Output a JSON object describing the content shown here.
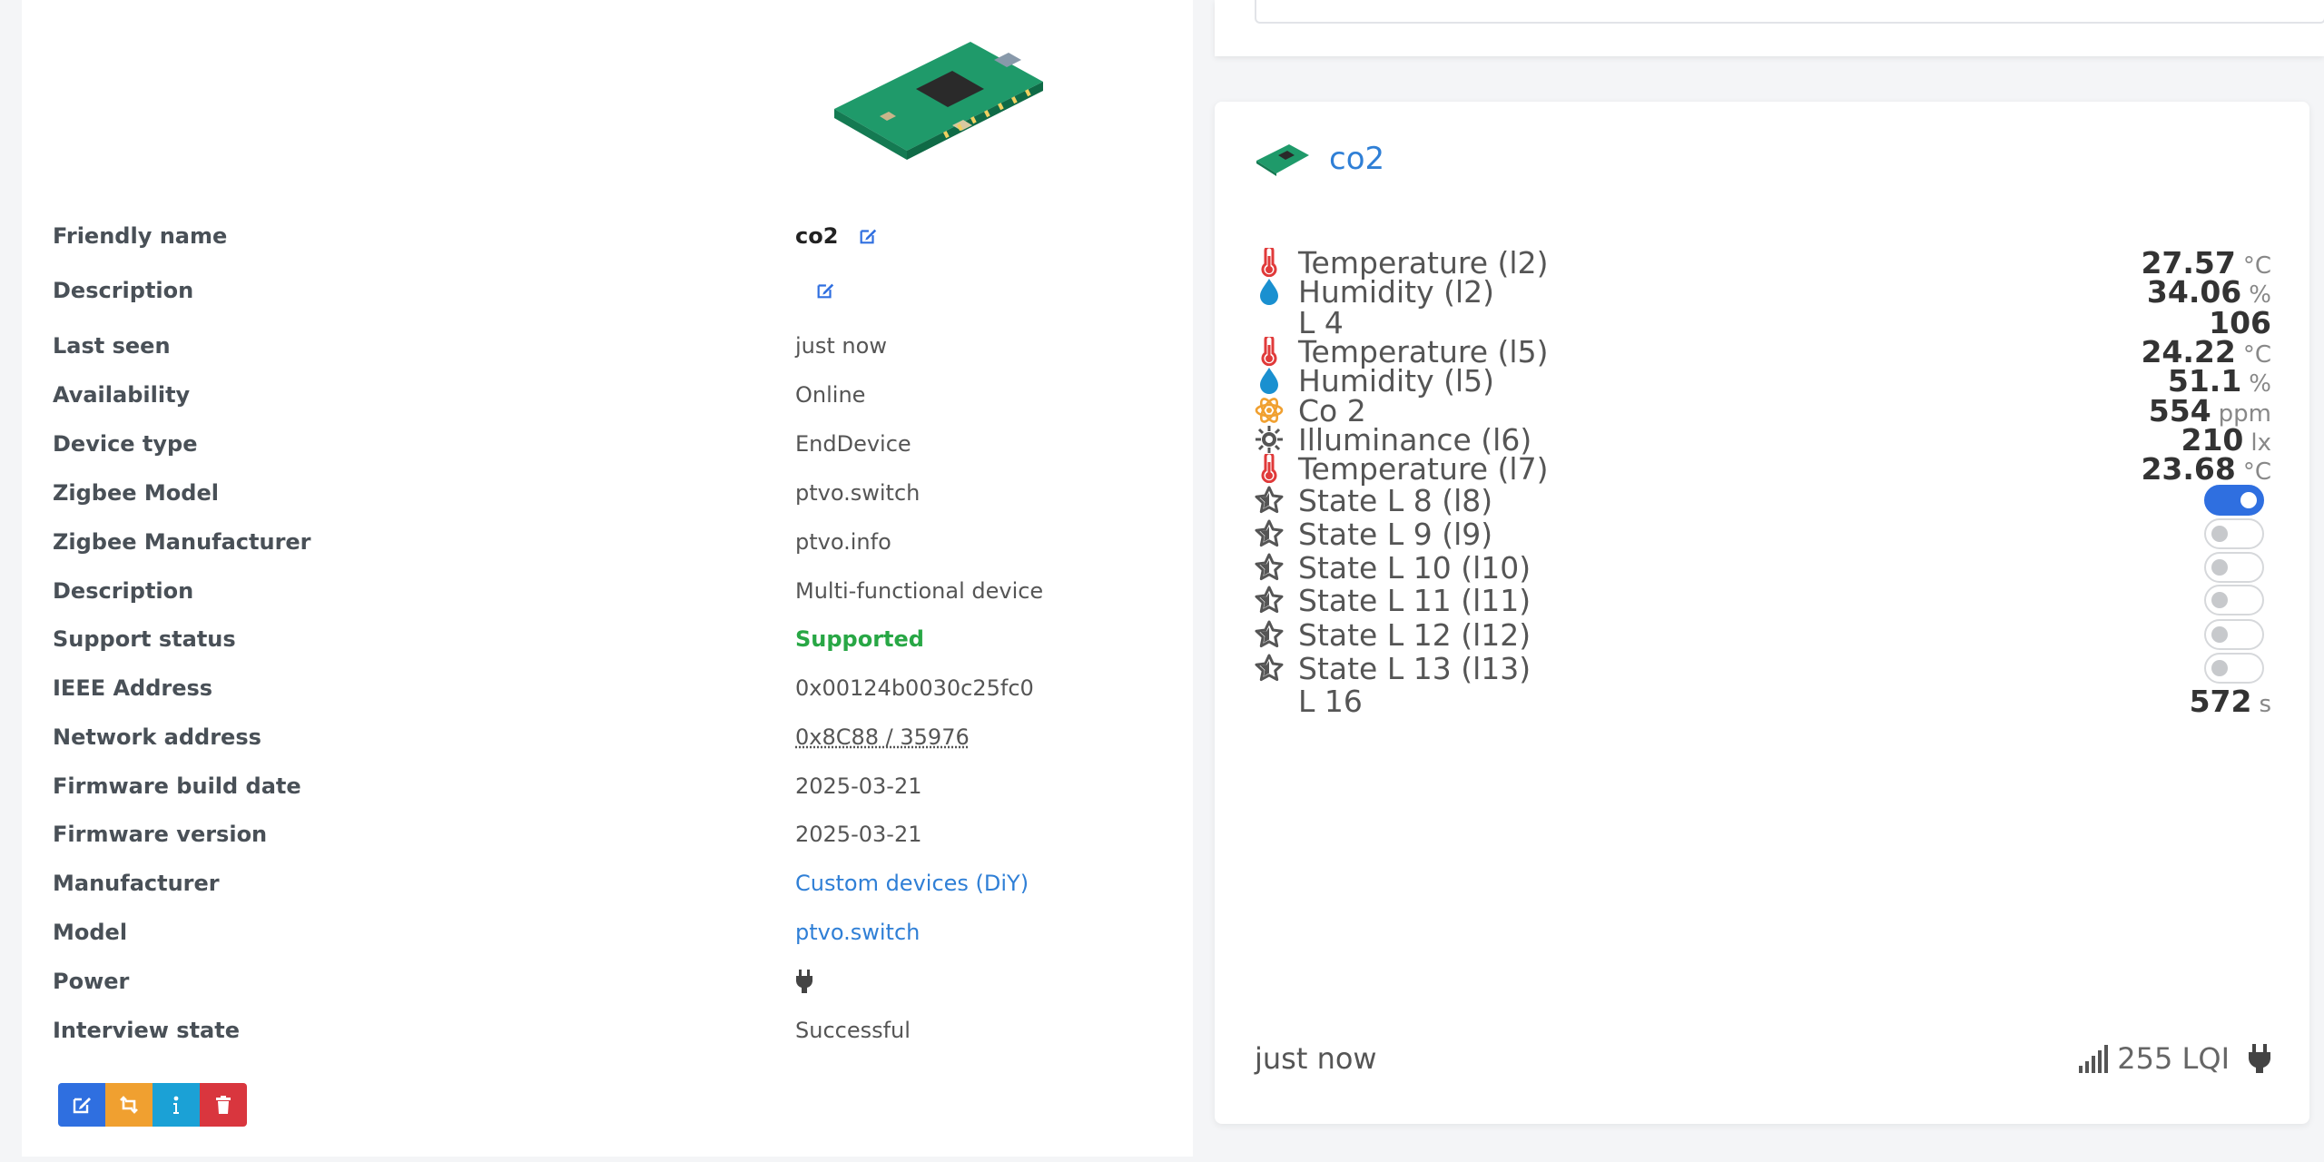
{
  "device_info": {
    "rows": [
      {
        "label": "Friendly name",
        "value": "co2"
      },
      {
        "label": "Description",
        "value": ""
      },
      {
        "label": "Last seen",
        "value": "just now"
      },
      {
        "label": "Availability",
        "value": "Online"
      },
      {
        "label": "Device type",
        "value": "EndDevice"
      },
      {
        "label": "Zigbee Model",
        "value": "ptvo.switch"
      },
      {
        "label": "Zigbee Manufacturer",
        "value": "ptvo.info"
      },
      {
        "label": "Description",
        "value": "Multi-functional device"
      },
      {
        "label": "Support status",
        "value": "Supported"
      },
      {
        "label": "IEEE Address",
        "value": "0x00124b0030c25fc0"
      },
      {
        "label": "Network address",
        "value": "0x8C88 / 35976"
      },
      {
        "label": "Firmware build date",
        "value": "2025-03-21"
      },
      {
        "label": "Firmware version",
        "value": "2025-03-21"
      },
      {
        "label": "Manufacturer",
        "value": "Custom devices (DiY)"
      },
      {
        "label": "Model",
        "value": "ptvo.switch"
      },
      {
        "label": "Power",
        "value": ""
      },
      {
        "label": "Interview state",
        "value": "Successful"
      }
    ]
  },
  "actions": [
    "edit-icon",
    "rename-icon",
    "info-icon",
    "trash-icon"
  ],
  "card": {
    "title": "co2",
    "features": [
      {
        "icon": "thermometer-icon",
        "label": "Temperature (l2)",
        "value": "27.57",
        "unit": "°C"
      },
      {
        "icon": "droplet-icon",
        "label": "Humidity (l2)",
        "value": "34.06",
        "unit": "%"
      },
      {
        "icon": "",
        "label": "L 4",
        "value": "106",
        "unit": ""
      },
      {
        "icon": "thermometer-icon",
        "label": "Temperature (l5)",
        "value": "24.22",
        "unit": "°C"
      },
      {
        "icon": "droplet-icon",
        "label": "Humidity (l5)",
        "value": "51.1",
        "unit": "%"
      },
      {
        "icon": "atom-icon",
        "label": "Co 2",
        "value": "554",
        "unit": "ppm"
      },
      {
        "icon": "sun-icon",
        "label": "Illuminance (l6)",
        "value": "210",
        "unit": "lx"
      },
      {
        "icon": "thermometer-icon",
        "label": "Temperature (l7)",
        "value": "23.68",
        "unit": "°C"
      },
      {
        "icon": "star-icon",
        "label": "State L 8 (l8)",
        "toggle": true
      },
      {
        "icon": "star-icon",
        "label": "State L 9 (l9)",
        "toggle": false
      },
      {
        "icon": "star-icon",
        "label": "State L 10 (l10)",
        "toggle": false
      },
      {
        "icon": "star-icon",
        "label": "State L 11 (l11)",
        "toggle": false
      },
      {
        "icon": "star-icon",
        "label": "State L 12 (l12)",
        "toggle": false
      },
      {
        "icon": "star-icon",
        "label": "State L 13 (l13)",
        "toggle": false
      },
      {
        "icon": "",
        "label": "L 16",
        "value": "572",
        "unit": "s"
      }
    ],
    "footer": {
      "last_seen": "just now",
      "lqi": "255 LQI"
    }
  },
  "colors": {
    "accent": "#2f6fe0",
    "link": "#2f7fd6",
    "success": "#28a745",
    "danger": "#d9363e",
    "warning": "#f0a030",
    "info": "#1ba1d6"
  }
}
